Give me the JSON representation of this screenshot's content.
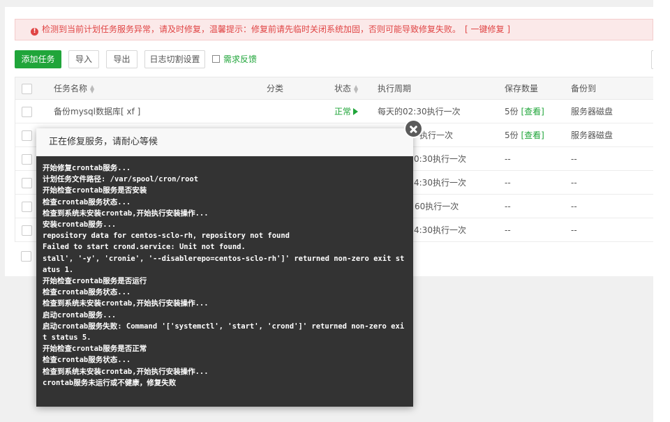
{
  "alert": {
    "message": "检测到当前计划任务服务异常，请及时修复，温馨提示：修复前请先临时关闭系统加固，否则可能导致修复失败。",
    "fix_link": "[ 一键修复 ]"
  },
  "toolbar": {
    "add_task": "添加任务",
    "import": "导入",
    "export": "导出",
    "log_cut": "日志切割设置",
    "feedback": "需求反馈"
  },
  "table": {
    "headers": {
      "name": "任务名称",
      "category": "分类",
      "status": "状态",
      "period": "执行周期",
      "keep": "保存数量",
      "backup_to": "备份到"
    },
    "rows": [
      {
        "name": "备份mysql数据库[ xf ]",
        "category": "",
        "status": "正常",
        "period": "每天的02:30执行一次",
        "keep": "5份",
        "view": "[查看]",
        "backup_to": "服务器磁盘"
      },
      {
        "name": "",
        "category": "",
        "status": "",
        "period": "执行一次",
        "keep": "5份",
        "view": "[查看]",
        "backup_to": "服务器磁盘"
      },
      {
        "name": "",
        "category": "",
        "status": "",
        "period": "0:30执行一次",
        "keep": "--",
        "view": "",
        "backup_to": "--"
      },
      {
        "name": "",
        "category": "",
        "status": "",
        "period": "4:30执行一次",
        "keep": "--",
        "view": "",
        "backup_to": "--"
      },
      {
        "name": "",
        "category": "",
        "status": "",
        "period": "60执行一次",
        "keep": "--",
        "view": "",
        "backup_to": "--"
      },
      {
        "name": "",
        "category": "",
        "status": "",
        "period": "4:30执行一次",
        "keep": "--",
        "view": "",
        "backup_to": "--"
      }
    ]
  },
  "modal": {
    "title": "正在修复服务，请耐心等候",
    "log": [
      "开始修复crontab服务...",
      "计划任务文件路径: /var/spool/cron/root",
      "开始检查crontab服务是否安装",
      "检查crontab服务状态...",
      "检查到系统未安装crontab,开始执行安装操作...",
      "安装crontab服务...",
      "repository data for centos-sclo-rh, repository not found",
      "Failed to start crond.service: Unit not found.",
      "stall', '-y', 'cronie', '--disablerepo=centos-sclo-rh']' returned non-zero exit status 1.",
      "开始检查crontab服务是否运行",
      "检查crontab服务状态...",
      "检查到系统未安装crontab,开始执行安装操作...",
      "启动crontab服务...",
      "启动crontab服务失败: Command '['systemctl', 'start', 'crond']' returned non-zero exit status 5.",
      "开始检查crontab服务是否正常",
      "检查crontab服务状态...",
      "检查到系统未安装crontab,开始执行安装操作...",
      "crontab服务未运行或不健康，修复失败"
    ]
  },
  "colors": {
    "accent": "#20a53a",
    "danger": "#e04545",
    "modal_bg": "#333333"
  }
}
